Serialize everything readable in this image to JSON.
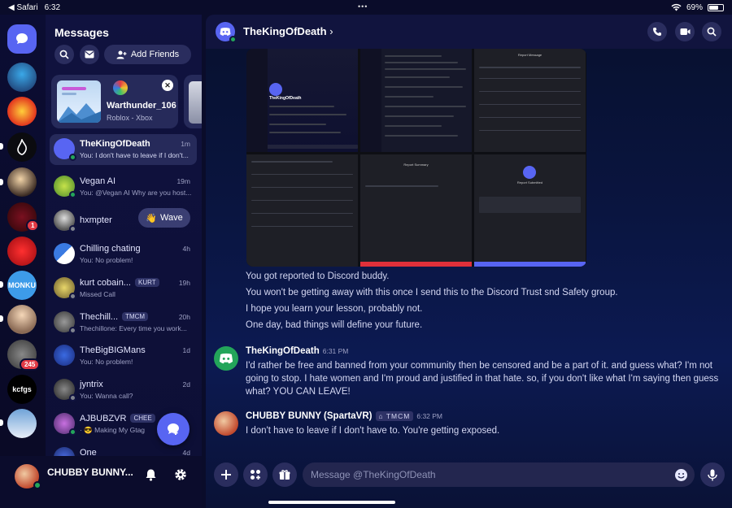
{
  "statusbar": {
    "back_app": "◀ Safari",
    "time": "6:32",
    "battery": "69%",
    "battery_level": 0.69,
    "dots": "•••"
  },
  "rail": {
    "servers": [
      {
        "name": "Direct Messages",
        "label": ""
      },
      {
        "name": "server-1",
        "label": ""
      },
      {
        "name": "server-2",
        "label": ""
      },
      {
        "name": "server-3",
        "label": ""
      },
      {
        "name": "server-4",
        "label": ""
      },
      {
        "name": "server-5",
        "label": "",
        "badge": "1"
      },
      {
        "name": "server-6",
        "label": ""
      },
      {
        "name": "server-7",
        "label": "MONKU"
      },
      {
        "name": "server-8",
        "label": ""
      },
      {
        "name": "server-9",
        "label": "",
        "badge": "245"
      },
      {
        "name": "server-10",
        "label": "kcfgs"
      },
      {
        "name": "server-11",
        "label": ""
      }
    ]
  },
  "dm_panel": {
    "title": "Messages",
    "add_friends": "Add Friends",
    "activity": {
      "name": "Warthunder_106",
      "sub": "Roblox - Xbox"
    },
    "dms": [
      {
        "name": "TheKingOfDeath",
        "preview": "You: I don't have to leave if I don't...",
        "time": "1m",
        "online": true
      },
      {
        "name": "Vegan AI",
        "preview": "You: @Vegan AI Why are you host...",
        "time": "19m",
        "online": true
      },
      {
        "name": "hxmpter",
        "preview": "",
        "time": "",
        "action": "Wave",
        "online": false
      },
      {
        "name": "Chilling chating",
        "preview": "You: No problem!",
        "time": "4h",
        "online": false
      },
      {
        "name": "kurt cobain...",
        "preview": "Missed Call",
        "time": "19h",
        "chip": "KURT",
        "online": false
      },
      {
        "name": "Thechill...",
        "preview": "Thechillone: Every time you work...",
        "time": "20h",
        "chip": "TMCM",
        "online": false
      },
      {
        "name": "TheBigBIGMans",
        "preview": "You: No problem!",
        "time": "1d",
        "online": false
      },
      {
        "name": "jyntrix",
        "preview": "You: Wanna call?",
        "time": "2d",
        "online": false
      },
      {
        "name": "AJBUBZVR",
        "preview": "· 😎 Making My Gtag",
        "time": "",
        "chip": "CHEE",
        "online": true
      },
      {
        "name": "One",
        "preview": "",
        "time": "4d",
        "online": false
      }
    ]
  },
  "user": {
    "name": "CHUBBY BUNNY..."
  },
  "chat": {
    "title": "TheKingOfDeath",
    "screenshots": {
      "s1_name": "TheKingOfDeath",
      "s3_title": "Report Message",
      "s5_title": "Report Summary",
      "s6_title": "Report Submitted"
    },
    "continuation": [
      "You got reported to Discord buddy.",
      "You won't be getting away with this once I send this to the Discord Trust snd Safety group.",
      "I hope you learn your lesson, probably not.",
      "One day, bad things will define your future."
    ],
    "messages": [
      {
        "author": "TheKingOfDeath",
        "time": "6:31 PM",
        "tag": "",
        "text": "I'd rather be free and banned from your community then be censored and be a part of it. and guess what? I'm not going to stop. I hate women and I'm proud and justified in that hate. so, if you don't like what I'm saying then guess what? YOU CAN LEAVE!"
      },
      {
        "author": "CHUBBY BUNNY (SpartaVR)",
        "time": "6:32 PM",
        "tag": "TMCM",
        "text": "I don't have to leave if I don't have to. You're getting exposed."
      }
    ],
    "composer_placeholder": "Message @TheKingOfDeath"
  },
  "colors": {
    "blurple": "#5865f2",
    "online": "#23a55a",
    "badge": "#e23a45"
  }
}
